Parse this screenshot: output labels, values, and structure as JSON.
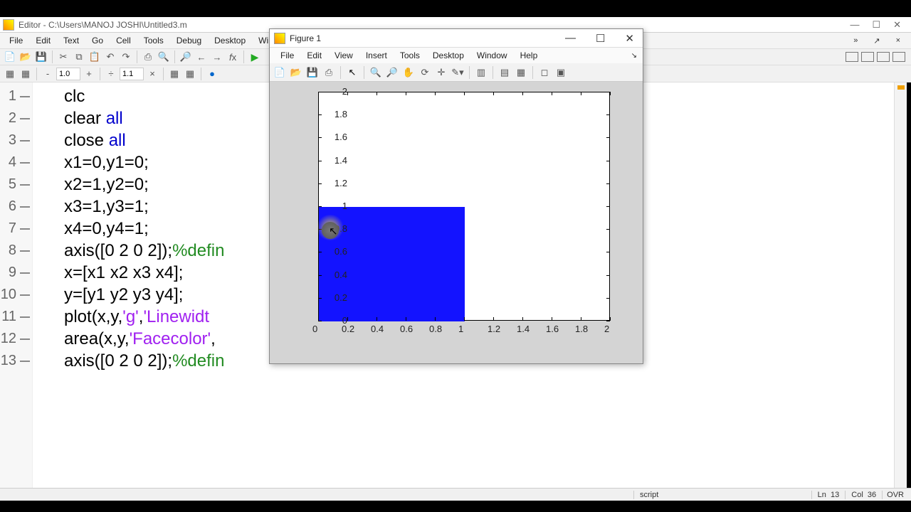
{
  "outer_title": "Editor - C:\\Users\\MANOJ JOSHI\\Untitled3.m",
  "main_menu": [
    "File",
    "Edit",
    "Text",
    "Go",
    "Cell",
    "Tools",
    "Debug",
    "Desktop",
    "Window"
  ],
  "toolbar2_vals": {
    "zoom_out": "1.0",
    "zoom_in": "1.1"
  },
  "code_lines_raw": [
    "clc",
    "clear all",
    "close all",
    "x1=0,y1=0;",
    "x2=1,y2=0;",
    "x3=1,y3=1;",
    "x4=0,y4=1;",
    "axis([0 2 0 2]);%defin",
    "x=[x1 x2 x3 x4];",
    "y=[y1 y2 y3 y4];",
    "plot(x,y,'g','Linewidt",
    "area(x,y,'Facecolor',",
    "axis([0 2 0 2]);%defin"
  ],
  "code_lines": [
    {
      "n": 1,
      "plain": "clc"
    },
    {
      "n": 2,
      "pre": "clear ",
      "kw": "all"
    },
    {
      "n": 3,
      "pre": "close ",
      "kw": "all"
    },
    {
      "n": 4,
      "plain": "x1=0,y1=0;"
    },
    {
      "n": 5,
      "plain": "x2=1,y2=0;"
    },
    {
      "n": 6,
      "plain": "x3=1,y3=1;"
    },
    {
      "n": 7,
      "plain": "x4=0,y4=1;"
    },
    {
      "n": 8,
      "pre": "axis([0 2 0 2]);",
      "cmt": "%defin"
    },
    {
      "n": 9,
      "plain": "x=[x1 x2 x3 x4];"
    },
    {
      "n": 10,
      "plain": "y=[y1 y2 y3 y4];"
    },
    {
      "n": 11,
      "pre": "plot(x,y,",
      "str": "'g'",
      "mid": ",",
      "str2": "'Linewidt"
    },
    {
      "n": 12,
      "pre": "area(x,y,",
      "str": "'Facecolor'",
      "mid": ","
    },
    {
      "n": 13,
      "pre": "axis([0 2 0 2]);",
      "cmt": "%defin"
    }
  ],
  "figure": {
    "title": "Figure 1",
    "menu": [
      "File",
      "Edit",
      "View",
      "Insert",
      "Tools",
      "Desktop",
      "Window",
      "Help"
    ]
  },
  "chart_data": {
    "type": "area",
    "x": [
      0,
      1,
      1,
      0
    ],
    "y": [
      0,
      0,
      1,
      1
    ],
    "facecolor": "#1313ff",
    "xlim": [
      0,
      2
    ],
    "ylim": [
      0,
      2
    ],
    "xticks": [
      0,
      0.2,
      0.4,
      0.6,
      0.8,
      1,
      1.2,
      1.4,
      1.6,
      1.8,
      2
    ],
    "yticks": [
      0,
      0.2,
      0.4,
      0.6,
      0.8,
      1,
      1.2,
      1.4,
      1.6,
      1.8,
      2
    ],
    "title": "",
    "xlabel": "",
    "ylabel": ""
  },
  "status": {
    "mode": "script",
    "ln_label": "Ln",
    "ln": "13",
    "col_label": "Col",
    "col": "36",
    "ovr": "OVR"
  }
}
